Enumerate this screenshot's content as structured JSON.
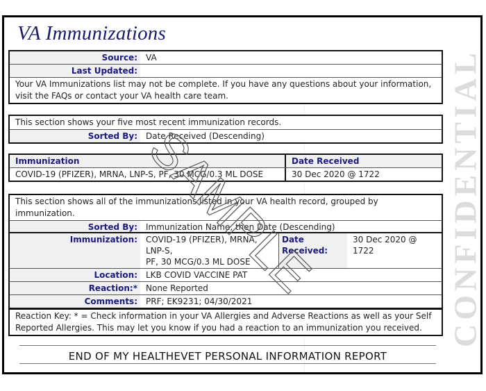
{
  "title": "VA Immunizations",
  "info_box": {
    "source_label": "Source:",
    "source_value": "VA",
    "updated_label": "Last Updated:",
    "updated_value": "",
    "notice_line1": "Your VA Immunizations list may not be complete.  If you have any questions about your information,",
    "notice_line2": "visit the FAQs or contact your VA health care team."
  },
  "recent_section": {
    "description": "This section shows your five most recent immunization records.",
    "sorted_label": "Sorted By:",
    "sorted_value": "Date Received (Descending)"
  },
  "recent_table": {
    "headers": [
      "Immunization",
      "Date Received"
    ],
    "rows": [
      {
        "immunization": "COVID-19 (PFIZER), MRNA, LNP-S, PF, 30 MCG/0.3 ML DOSE",
        "date": "30 Dec 2020 @ 1722"
      }
    ]
  },
  "all_section": {
    "description": "This section shows all of the immunizations listed in your VA health record, grouped by immunization.",
    "sorted_label": "Sorted By:",
    "sorted_value": "Immunization Name, then Date (Descending)"
  },
  "detail": {
    "immunization_label": "Immunization:",
    "immunization_line1": "COVID-19 (PFIZER), MRNA, LNP-S,",
    "immunization_line2": "PF, 30 MCG/0.3 ML DOSE",
    "date_label": "Date Received:",
    "date_line1": "30 Dec 2020 @",
    "date_line2": "1722",
    "location_label": "Location:",
    "location_value": "LKB COVID VACCINE PAT",
    "reaction_label": "Reaction:*",
    "reaction_value": "None Reported",
    "comments_label": "Comments:",
    "comments_value": "PRF; EK9231; 04/30/2021"
  },
  "reaction_key": {
    "line1": "Reaction Key: * = Check information in your VA Allergies and Adverse Reactions as well as your Self",
    "line2": "Reported Allergies. This may let you know if you had a reaction to an immunization you received."
  },
  "footer": "END OF MY HEALTHEVET PERSONAL INFORMATION REPORT",
  "watermarks": {
    "diagonal": "SAMPLE",
    "side": "CONFIDENTIAL"
  },
  "colors": {
    "title": "#1a1a6e",
    "label": "#1a1a80",
    "label_bg": "#f0f0f0",
    "watermark": "#dcdcdc"
  }
}
